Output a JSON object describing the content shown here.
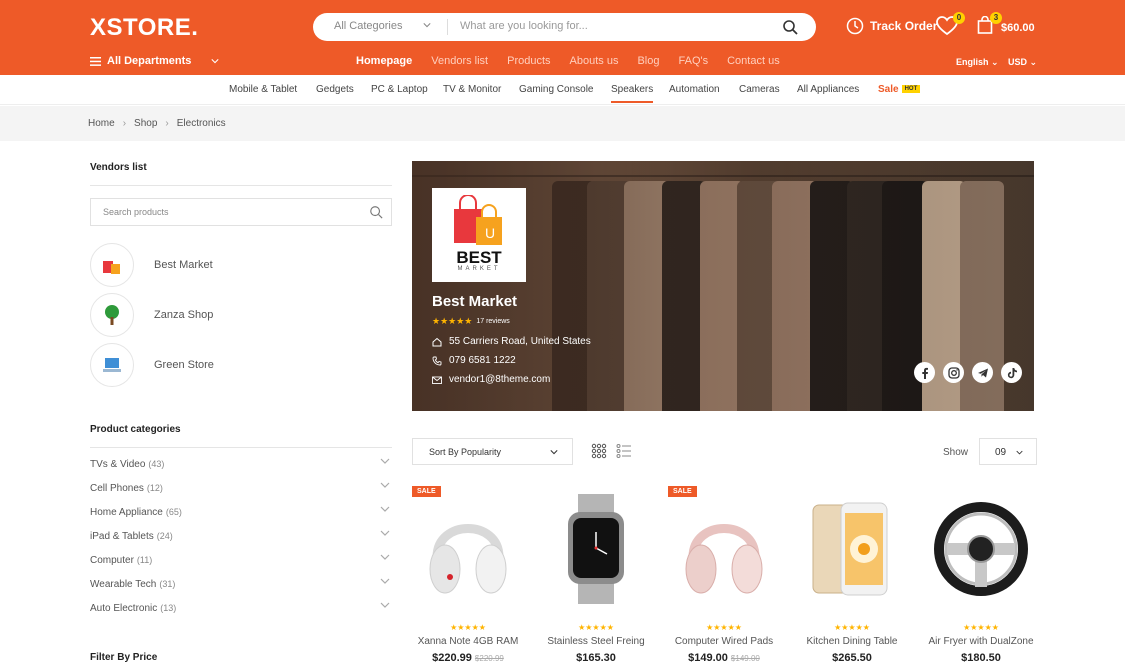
{
  "brand": {
    "logo": "XSTORE."
  },
  "search": {
    "category": "All Categories",
    "placeholder": "What are you looking for..."
  },
  "header": {
    "track_order": "Track Order",
    "wishlist_count": "0",
    "cart_count": "3",
    "cart_total": "$60.00",
    "departments": "All Departments",
    "language": "English",
    "currency": "USD"
  },
  "mainnav": [
    "Homepage",
    "Vendors list",
    "Products",
    "Abouts us",
    "Blog",
    "FAQ's",
    "Contact us"
  ],
  "catnav": [
    "Mobile & Tablet",
    "Gedgets",
    "PC & Laptop",
    "TV & Monitor",
    "Gaming Console",
    "Speakers",
    "Automation",
    "Cameras",
    "All Appliances"
  ],
  "catnav_sale": {
    "label": "Sale",
    "badge": "HOT"
  },
  "breadcrumb": [
    "Home",
    "Shop",
    "Electronics"
  ],
  "sidebar": {
    "vendors_title": "Vendors list",
    "search_placeholder": "Search products",
    "vendors": [
      "Best Market",
      "Zanza Shop",
      "Green Store"
    ],
    "categories_title": "Product categories",
    "categories": [
      {
        "name": "TVs & Video",
        "count": "(43)"
      },
      {
        "name": "Cell Phones",
        "count": "(12)"
      },
      {
        "name": "Home Appliance",
        "count": "(65)"
      },
      {
        "name": "iPad & Tablets",
        "count": "(24)"
      },
      {
        "name": "Computer",
        "count": "(11)"
      },
      {
        "name": "Wearable Tech",
        "count": "(31)"
      },
      {
        "name": "Auto Electronic",
        "count": "(13)"
      }
    ],
    "price_title": "Filter By Price"
  },
  "store": {
    "logo_word": "BEST",
    "logo_sub": "MARKET",
    "logo_bag_letter": "U",
    "name": "Best Market",
    "reviews": "17 reviews",
    "address": "55 Carriers Road, United States",
    "phone": "079 6581 1222",
    "email": "vendor1@8theme.com"
  },
  "toolbar": {
    "sort": "Sort By Popularity",
    "show_label": "Show",
    "show_value": "09"
  },
  "products": [
    {
      "name": "Xanna Note 4GB RAM",
      "price": "$220.99",
      "old": "$220.99",
      "sale": "SALE"
    },
    {
      "name": "Stainless Steel Freing",
      "price": "$165.30",
      "old": "",
      "sale": ""
    },
    {
      "name": "Computer Wired Pads",
      "price": "$149.00",
      "old": "$149.00",
      "sale": "SALE"
    },
    {
      "name": "Kitchen Dining Table",
      "price": "$265.50",
      "old": "",
      "sale": ""
    },
    {
      "name": "Air Fryer with DualZone",
      "price": "$180.50",
      "old": "",
      "sale": ""
    }
  ],
  "colors": {
    "accent": "#ee5a28",
    "badge": "#ffd200",
    "star": "#ffb400"
  }
}
